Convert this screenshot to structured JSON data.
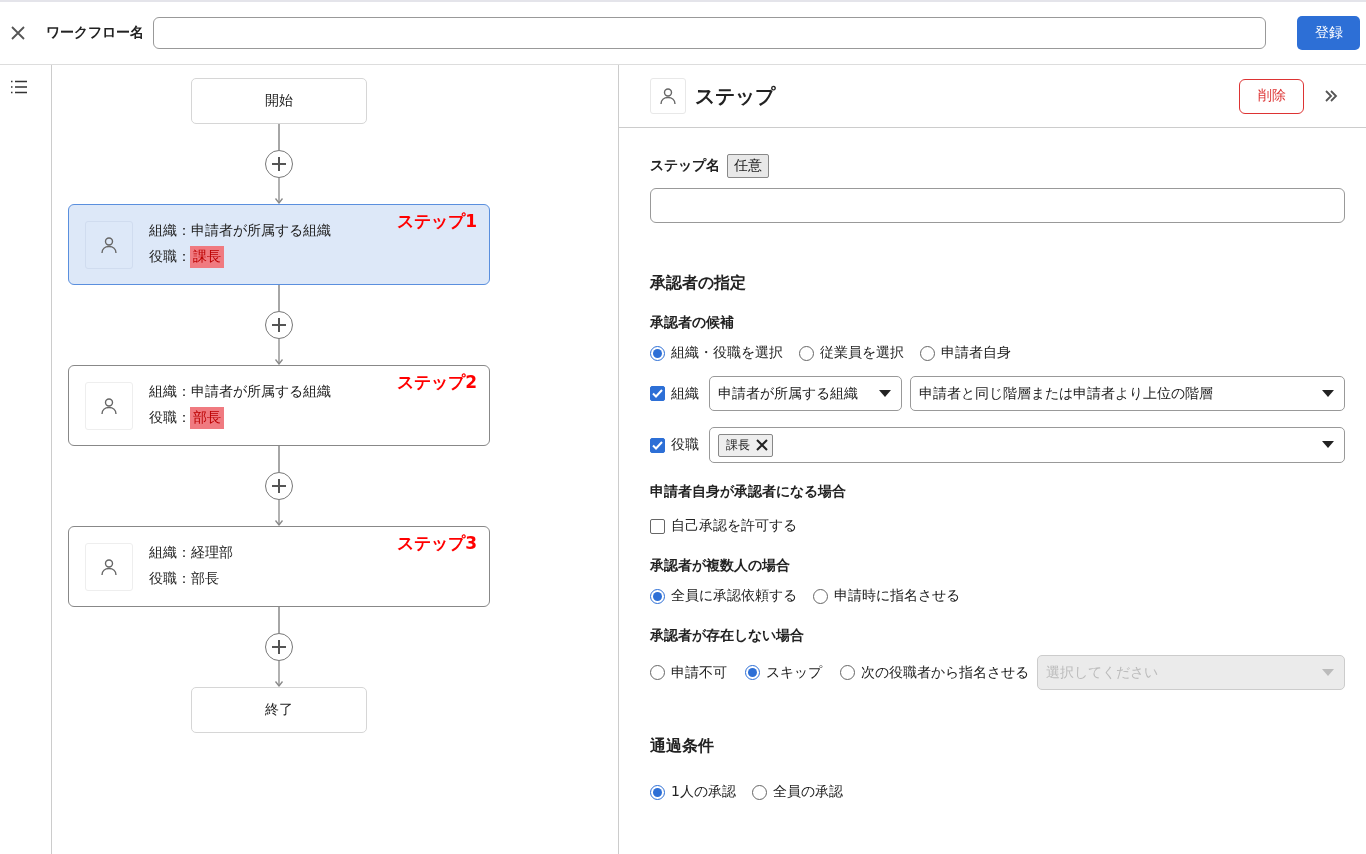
{
  "header": {
    "title": "ワークフロー名",
    "register_button": "登録"
  },
  "flow": {
    "nodes": [
      {
        "kind": "terminal",
        "label": "開始"
      },
      {
        "kind": "step",
        "selected": true,
        "org_line": "組織：申請者が所属する組織",
        "role_label": "役職：",
        "role": "課長",
        "role_highlighted": true,
        "annotation": "ステップ1"
      },
      {
        "kind": "step",
        "selected": false,
        "org_line": "組織：申請者が所属する組織",
        "role_label": "役職：",
        "role": "部長",
        "role_highlighted": true,
        "annotation": "ステップ2"
      },
      {
        "kind": "step",
        "selected": false,
        "org_line": "組織：経理部",
        "role_label": "役職：",
        "role": "部長",
        "role_highlighted": false,
        "annotation": "ステップ3"
      },
      {
        "kind": "terminal",
        "label": "終了"
      }
    ]
  },
  "panel": {
    "title": "ステップ",
    "delete_button": "削除",
    "step_name": {
      "label": "ステップ名",
      "badge": "任意"
    },
    "approver_heading": "承認者の指定",
    "candidates": {
      "label": "承認者の候補",
      "options": [
        {
          "label": "組織・役職を選択",
          "selected": true
        },
        {
          "label": "従業員を選択",
          "selected": false
        },
        {
          "label": "申請者自身",
          "selected": false
        }
      ]
    },
    "org_filter": {
      "label": "組織",
      "checked": true,
      "scope": "申請者が所属する組織",
      "level": "申請者と同じ階層または申請者より上位の階層"
    },
    "role_filter": {
      "label": "役職",
      "checked": true,
      "tags": [
        "課長"
      ]
    },
    "self_approval": {
      "heading": "申請者自身が承認者になる場合",
      "label": "自己承認を許可する",
      "checked": false
    },
    "multiple": {
      "heading": "承認者が複数人の場合",
      "options": [
        {
          "label": "全員に承認依頼する",
          "selected": true
        },
        {
          "label": "申請時に指名させる",
          "selected": false
        }
      ]
    },
    "absent": {
      "heading": "承認者が存在しない場合",
      "options": [
        {
          "label": "申請不可",
          "selected": false
        },
        {
          "label": "スキップ",
          "selected": true
        },
        {
          "label": "次の役職者から指名させる",
          "selected": false
        }
      ],
      "select": {
        "placeholder": "選択してください",
        "disabled": true
      }
    },
    "pass_condition": {
      "heading": "通過条件",
      "options": [
        {
          "label": "1人の承認",
          "selected": true
        },
        {
          "label": "全員の承認",
          "selected": false
        }
      ]
    }
  }
}
